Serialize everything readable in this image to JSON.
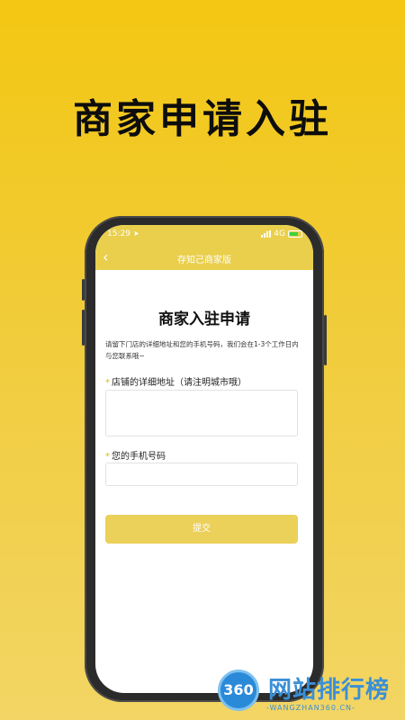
{
  "headline": "商家申请入驻",
  "status_bar": {
    "time": "15:29",
    "network": "4G"
  },
  "nav": {
    "back_icon": "‹",
    "title": "存知己商家版"
  },
  "form": {
    "title": "商家入驻申请",
    "intro": "请留下门店的详细地址和您的手机号码，我们会在1-3个工作日内与您联系哦~",
    "required_mark": "*",
    "address_label": "店铺的详细地址（请注明城市哦）",
    "address_value": "",
    "phone_label": "您的手机号码",
    "phone_value": "",
    "submit_label": "提交"
  },
  "watermark": {
    "badge": "360",
    "name": "网站排行榜",
    "domain": "-WANGZHAN360.CN-"
  },
  "colors": {
    "background": "#f3c712",
    "accent": "#e9cf4c",
    "button": "#ebd05a"
  }
}
